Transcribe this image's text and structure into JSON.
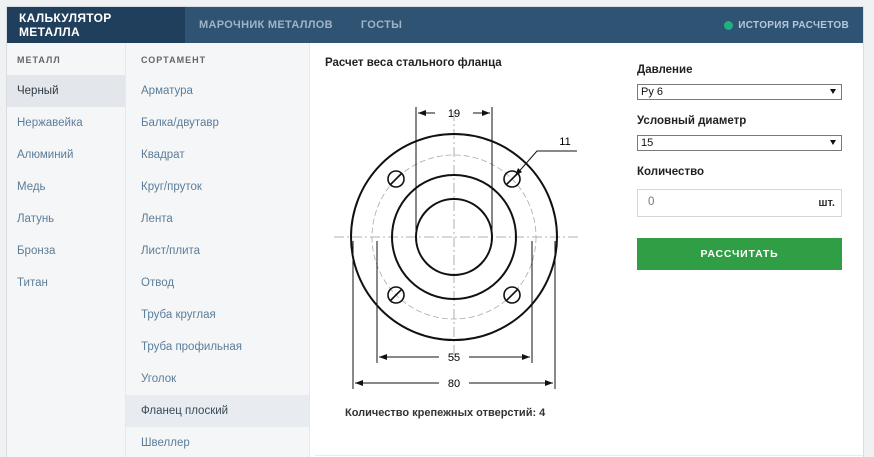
{
  "navbar": {
    "brand": "КАЛЬКУЛЯТОР МЕТАЛЛА",
    "items": [
      "МАРОЧНИК МЕТАЛЛОВ",
      "ГОСТЫ"
    ],
    "history": "ИСТОРИЯ РАСЧЕТОВ"
  },
  "metal": {
    "header": "МЕТАЛЛ",
    "items": [
      "Черный",
      "Нержавейка",
      "Алюминий",
      "Медь",
      "Латунь",
      "Бронза",
      "Титан"
    ],
    "active": "Черный"
  },
  "sortament": {
    "header": "СОРТАМЕНТ",
    "items": [
      "Арматура",
      "Балка/двутавр",
      "Квадрат",
      "Круг/пруток",
      "Лента",
      "Лист/плита",
      "Отвод",
      "Труба круглая",
      "Труба профильная",
      "Уголок",
      "Фланец плоский",
      "Швеллер"
    ],
    "active": "Фланец плоский"
  },
  "drawing": {
    "title": "Расчет веса стального фланца",
    "dim_top": "19",
    "dim_hole": "11",
    "dim_inner": "55",
    "dim_outer": "80",
    "holes_text": "Количество крепежных отверстий: 4"
  },
  "form": {
    "pressure_label": "Давление",
    "pressure_value": "Ру 6",
    "diameter_label": "Условный диаметр",
    "diameter_value": "15",
    "quantity_label": "Количество",
    "quantity_placeholder": "0",
    "quantity_unit": "шт.",
    "calc_button": "РАССЧИТАТЬ"
  },
  "colors": {
    "navbar": "#2e5373",
    "brand": "#1f3f5c",
    "accent_green": "#2f9e45",
    "history_dot": "#21b07e"
  }
}
